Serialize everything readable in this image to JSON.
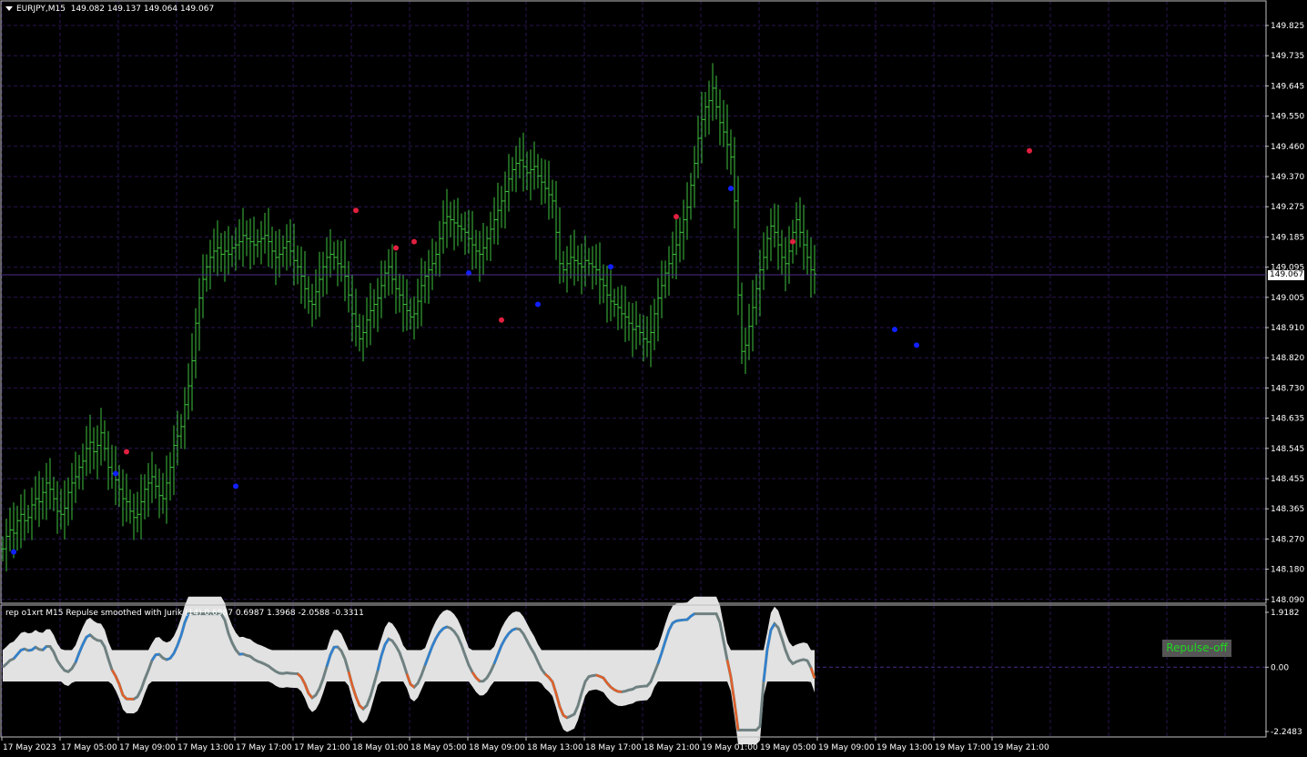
{
  "header": {
    "symbol": "EURJPY,M15",
    "ohlc": "149.082 149.137 149.064 149.067"
  },
  "price_axis": {
    "labels": [
      "149.825",
      "149.735",
      "149.645",
      "149.550",
      "149.460",
      "149.370",
      "149.275",
      "149.185",
      "149.095",
      "149.005",
      "148.910",
      "148.820",
      "148.730",
      "148.635",
      "148.545",
      "148.455",
      "148.365",
      "148.270",
      "148.180",
      "148.090"
    ],
    "current_price": "149.067"
  },
  "indicator": {
    "title": "rep o1xrt M15 Repulse smoothed with Jurik (14) 0.6987 0.6987 1.3968 -2.0588 -0.3311",
    "axis_labels": [
      "1.9182",
      "0.00",
      "-2.2483"
    ],
    "button_label": "Repulse-off"
  },
  "time_axis": {
    "labels": [
      "17 May 2023",
      "17 May 05:00",
      "17 May 09:00",
      "17 May 13:00",
      "17 May 17:00",
      "17 May 21:00",
      "18 May 01:00",
      "18 May 05:00",
      "18 May 09:00",
      "18 May 13:00",
      "18 May 17:00",
      "18 May 21:00",
      "19 May 01:00",
      "19 May 05:00",
      "19 May 09:00",
      "19 May 13:00",
      "19 May 17:00",
      "19 May 21:00"
    ]
  },
  "colors": {
    "background": "#000000",
    "grid": "#2a1550",
    "bars": "#3ec23e",
    "dot_red": "#e02040",
    "dot_blue": "#1020ff",
    "band": "#e2e2e2",
    "repulse_up": "#2f80d0",
    "repulse_down": "#e0602a",
    "repulse_main": "#6f8080"
  },
  "chart_data": {
    "type": "ohlc",
    "y_range": [
      148.06,
      149.86
    ],
    "closes": [
      148.19,
      148.23,
      148.25,
      148.24,
      148.28,
      148.3,
      148.28,
      148.29,
      148.33,
      148.35,
      148.34,
      148.37,
      148.4,
      148.38,
      148.35,
      148.31,
      148.3,
      148.32,
      148.37,
      148.4,
      148.42,
      148.45,
      148.47,
      148.51,
      148.53,
      148.5,
      148.52,
      148.56,
      148.51,
      148.45,
      148.43,
      148.41,
      148.38,
      148.35,
      148.34,
      148.31,
      148.29,
      148.3,
      148.34,
      148.38,
      148.4,
      148.42,
      148.39,
      148.36,
      148.35,
      148.4,
      148.45,
      148.52,
      148.55,
      148.58,
      148.65,
      148.71,
      148.79,
      148.91,
      148.99,
      149.05,
      149.09,
      149.12,
      149.14,
      149.15,
      149.13,
      149.14,
      149.13,
      149.15,
      149.16,
      149.17,
      149.19,
      149.18,
      149.17,
      149.16,
      149.17,
      149.18,
      149.19,
      149.17,
      149.14,
      149.12,
      149.13,
      149.15,
      149.17,
      149.14,
      149.11,
      149.09,
      149.06,
      149.02,
      148.98,
      148.97,
      149.01,
      149.05,
      149.09,
      149.12,
      149.13,
      149.12,
      149.1,
      149.09,
      149.06,
      149.0,
      148.94,
      148.9,
      148.86,
      148.88,
      148.92,
      148.95,
      148.97,
      148.99,
      149.03,
      149.07,
      149.09,
      149.05,
      149.02,
      149.0,
      148.97,
      148.95,
      148.93,
      148.94,
      148.98,
      149.03,
      149.06,
      149.08,
      149.1,
      149.13,
      149.18,
      149.23,
      149.25,
      149.24,
      149.23,
      149.22,
      149.21,
      149.2,
      149.18,
      149.16,
      149.14,
      149.13,
      149.15,
      149.18,
      149.21,
      149.24,
      149.27,
      149.3,
      149.33,
      149.37,
      149.4,
      149.42,
      149.43,
      149.41,
      149.39,
      149.4,
      149.41,
      149.38,
      149.36,
      149.34,
      149.32,
      149.3,
      149.2,
      149.1,
      149.08,
      149.1,
      149.12,
      149.11,
      149.1,
      149.09,
      149.11,
      149.1,
      149.09,
      149.08,
      149.05,
      149.03,
      149.0,
      148.98,
      148.97,
      148.96,
      148.94,
      148.93,
      148.91,
      148.89,
      148.9,
      148.88,
      148.86,
      148.85,
      148.88,
      148.94,
      148.99,
      149.03,
      149.07,
      149.1,
      149.13,
      149.16,
      149.2,
      149.24,
      149.28,
      149.35,
      149.42,
      149.5,
      149.56,
      149.6,
      149.62,
      149.66,
      149.6,
      149.55,
      149.52,
      149.48,
      149.44,
      149.3,
      149.0,
      148.82,
      148.84,
      148.9,
      148.96,
      149.02,
      149.08,
      149.12,
      149.18,
      149.22,
      149.2,
      149.16,
      149.12,
      149.1,
      149.14,
      149.2,
      149.24,
      149.2,
      149.16,
      149.12,
      149.08,
      149.067
    ],
    "red_dots": [
      [
        34,
        148.5
      ],
      [
        97,
        149.27
      ],
      [
        108,
        149.15
      ],
      [
        113,
        149.17
      ],
      [
        137,
        148.92
      ],
      [
        185,
        149.25
      ],
      [
        217,
        149.17
      ],
      [
        282,
        149.46
      ]
    ],
    "blue_dots": [
      [
        3,
        148.18
      ],
      [
        31,
        148.43
      ],
      [
        64,
        148.39
      ],
      [
        128,
        149.07
      ],
      [
        147,
        148.97
      ],
      [
        167,
        149.09
      ],
      [
        200,
        149.34
      ],
      [
        245,
        148.89
      ],
      [
        251,
        148.84
      ]
    ],
    "indicator_range": [
      -2.2483,
      1.9182
    ]
  }
}
